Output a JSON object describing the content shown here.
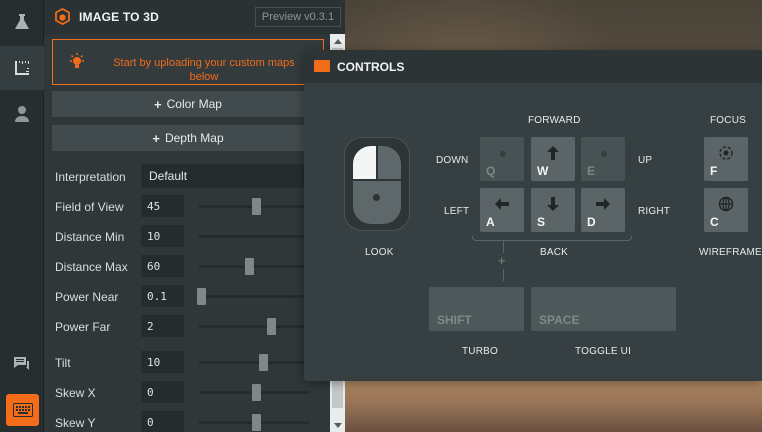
{
  "app": {
    "title": "IMAGE TO 3D",
    "version": "Preview v0.3.1"
  },
  "rail": {
    "items": [
      {
        "icon": "flask-icon"
      },
      {
        "icon": "ruler-icon"
      },
      {
        "icon": "user-icon"
      },
      {
        "icon": "chat-icon"
      },
      {
        "icon": "keyboard-icon"
      }
    ]
  },
  "notice": {
    "icon": "lightbulb-icon",
    "text": "Start by uploading your custom maps below"
  },
  "buttons": {
    "color_map": "Color Map",
    "depth_map": "Depth Map",
    "plus": "+"
  },
  "settings": {
    "interpretation": {
      "label": "Interpretation",
      "value": "Default"
    },
    "field_of_view": {
      "label": "Field of View",
      "value": "45",
      "level": 0.52
    },
    "distance_min": {
      "label": "Distance Min",
      "value": "10",
      "level": 0.0
    },
    "distance_max": {
      "label": "Distance Max",
      "value": "60",
      "level": 0.45
    },
    "power_near": {
      "label": "Power Near",
      "value": "0.1",
      "level": 0.02
    },
    "power_far": {
      "label": "Power Far",
      "value": "2",
      "level": 0.65
    },
    "tilt": {
      "label": "Tilt",
      "value": "10",
      "level": 0.58
    },
    "skew_x": {
      "label": "Skew X",
      "value": "0",
      "level": 0.52
    },
    "skew_y": {
      "label": "Skew Y",
      "value": "0",
      "level": 0.52
    }
  },
  "controls": {
    "title": "CONTROLS",
    "look": "LOOK",
    "forward": "FORWARD",
    "back": "BACK",
    "down": "DOWN",
    "up": "UP",
    "left": "LEFT",
    "right": "RIGHT",
    "focus": "FOCUS",
    "wireframe": "WIREFRAME",
    "turbo": "TURBO",
    "toggle_ui": "TOGGLE UI",
    "keys": {
      "q": "Q",
      "w": "W",
      "e": "E",
      "a": "A",
      "s": "S",
      "d": "D",
      "f": "F",
      "c": "C",
      "shift": "SHIFT",
      "space": "SPACE"
    },
    "plus": "+"
  },
  "colors": {
    "accent": "#f26c1a",
    "panel": "#2f3739",
    "modal": "#364043"
  }
}
